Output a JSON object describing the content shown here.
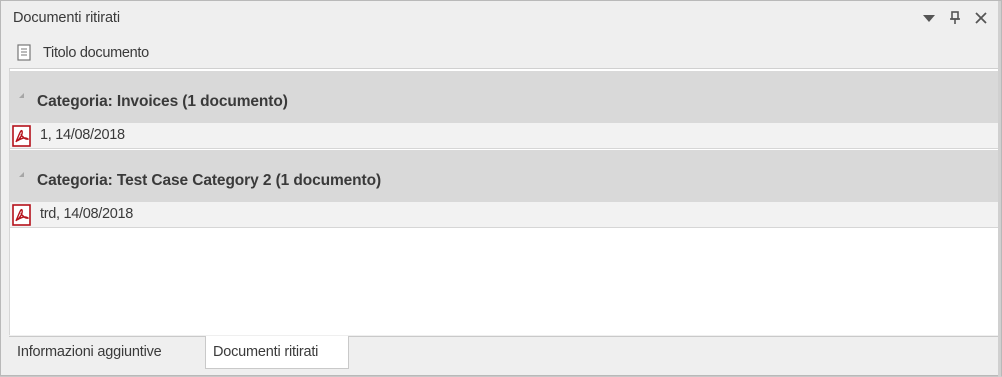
{
  "panel": {
    "title": "Documenti ritirati"
  },
  "toolbar_icons": [
    "dropdown-arrow-icon",
    "pin-icon",
    "close-icon"
  ],
  "column_header": {
    "label": "Titolo documento",
    "icon": "document-icon"
  },
  "groups": [
    {
      "label": "Categoria: Invoices (1 documento)",
      "rows": [
        {
          "text": "1, 14/08/2018",
          "icon": "pdf-icon"
        }
      ]
    },
    {
      "label": "Categoria: Test Case Category 2 (1 documento)",
      "rows": [
        {
          "text": "trd, 14/08/2018",
          "icon": "pdf-icon"
        }
      ]
    }
  ],
  "tabs": [
    {
      "label": "Informazioni aggiuntive",
      "active": false
    },
    {
      "label": "Documenti ritirati",
      "active": true
    }
  ],
  "colors": {
    "group_bg": "#d9d9d9",
    "row_bg": "#f2f2f2",
    "pdf_red": "#b5121b",
    "text": "#3a3a3a"
  }
}
